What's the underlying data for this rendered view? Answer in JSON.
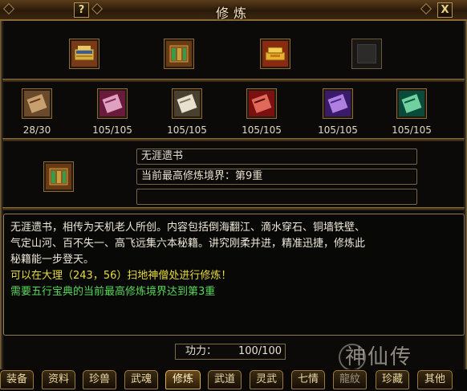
{
  "window": {
    "title": "修炼",
    "help_label": "?",
    "close_label": "X"
  },
  "top_items": [
    {
      "icon": "golden-book-icon"
    },
    {
      "icon": "green-scroll-book-icon"
    },
    {
      "icon": "gold-ingots-icon"
    },
    {
      "icon": "empty-slot-icon"
    }
  ],
  "scrolls": [
    {
      "icon": "scroll-brown-icon",
      "progress": "28/30"
    },
    {
      "icon": "scroll-pink-icon",
      "progress": "105/105"
    },
    {
      "icon": "scroll-white-icon",
      "progress": "105/105"
    },
    {
      "icon": "scroll-red-icon",
      "progress": "105/105"
    },
    {
      "icon": "scroll-purple-icon",
      "progress": "105/105"
    },
    {
      "icon": "scroll-green-icon",
      "progress": "105/105"
    }
  ],
  "selected": {
    "icon": "green-scroll-book-icon",
    "name": "无涯遗书",
    "level": "当前最高修炼境界：第9重",
    "extra": ""
  },
  "description": {
    "line1": "无涯遗书，相传为天机老人所创。内容包括倒海翻江、滴水穿石、铜墙铁壁、",
    "line2": "气定山河、百不失一、高飞远集六本秘籍。讲究刚柔并进，精准迅捷，修炼此",
    "line3": "秘籍能一步登天。",
    "location": "可以在大理（243，56）扫地神僧处进行修炼！",
    "requirement": "需要五行宝典的当前最高修炼境界达到第3重"
  },
  "power": {
    "label": "功力：",
    "value": "100/100"
  },
  "watermark": "神仙传",
  "tabs": [
    {
      "label": "装备",
      "state": "normal"
    },
    {
      "label": "资料",
      "state": "normal"
    },
    {
      "label": "珍兽",
      "state": "normal"
    },
    {
      "label": "武魂",
      "state": "normal"
    },
    {
      "label": "修炼",
      "state": "active"
    },
    {
      "label": "武道",
      "state": "normal"
    },
    {
      "label": "灵武",
      "state": "normal"
    },
    {
      "label": "七情",
      "state": "normal"
    },
    {
      "label": "龍紋",
      "state": "dim"
    },
    {
      "label": "珍藏",
      "state": "normal"
    },
    {
      "label": "其他",
      "state": "normal"
    }
  ],
  "colors": {
    "frame": "#6b5632",
    "text_yellow": "#e8dc3c",
    "text_green": "#58d858",
    "text_white": "#ece6d6"
  }
}
